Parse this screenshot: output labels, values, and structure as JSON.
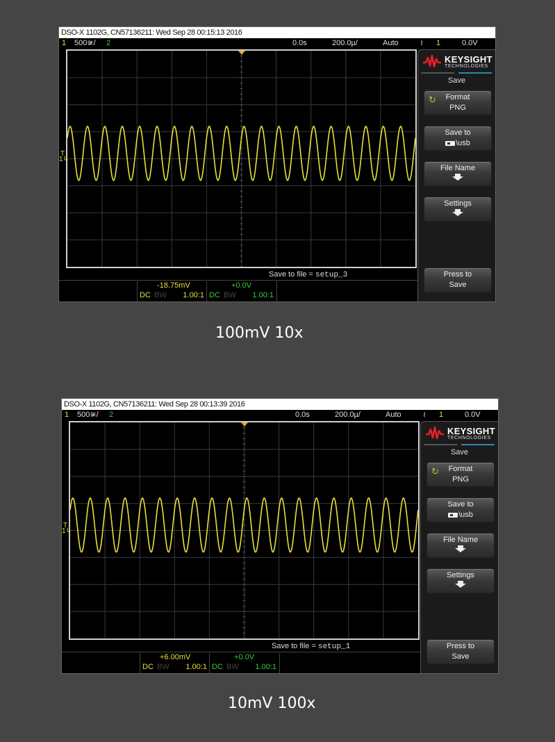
{
  "screens": [
    {
      "titlebar": "DSO-X 1102G, CN57136211: Wed Sep 28 00:15:13 2016",
      "status": {
        "ch1_num": "1",
        "ch1_scale": "500≆/",
        "ch2_num": "2",
        "time_offset": "0.0s",
        "time_scale": "200.0µ/",
        "trigger_mode": "Auto",
        "trigger_slope_icon": "≀",
        "trigger_source": "1",
        "trigger_level": "0.0V"
      },
      "waveform": {
        "channel": "1",
        "cycles_on_screen": 20,
        "amplitude_div": 1.0,
        "offset_div": 0.2,
        "color": "#e8e03a"
      },
      "trigger_label": "T",
      "channel_marker": "1",
      "save_file_label": "Save to file = ",
      "save_file_name": "setup_3",
      "ch1_info": {
        "value": "-18.75mV",
        "coupling": "DC",
        "bw": "BW",
        "probe": "1.00:1"
      },
      "ch2_info": {
        "value": "+0.0V",
        "coupling": "DC",
        "bw": "BW",
        "probe": "1.00:1"
      },
      "softkeys": {
        "brand": "KEYSIGHT",
        "brand_sub": "TECHNOLOGIES",
        "menu_title": "Save",
        "format": {
          "line1": "Format",
          "line2": "PNG"
        },
        "save_to": {
          "line1": "Save to",
          "line2": "\\usb"
        },
        "file_name": {
          "line1": "File Name"
        },
        "settings": {
          "line1": "Settings"
        },
        "press_save": {
          "line1": "Press to",
          "line2": "Save"
        }
      },
      "caption": "100mV 10x"
    },
    {
      "titlebar": "DSO-X 1102G, CN57136211: Wed Sep 28 00:13:39 2016",
      "status": {
        "ch1_num": "1",
        "ch1_scale": "500≆/",
        "ch2_num": "2",
        "time_offset": "0.0s",
        "time_scale": "200.0µ/",
        "trigger_mode": "Auto",
        "trigger_slope_icon": "≀",
        "trigger_source": "1",
        "trigger_level": "0.0V"
      },
      "waveform": {
        "channel": "1",
        "cycles_on_screen": 20,
        "amplitude_div": 1.0,
        "offset_div": 0.2,
        "color": "#e8e03a"
      },
      "trigger_label": "T",
      "channel_marker": "1",
      "save_file_label": "Save to file = ",
      "save_file_name": "setup_1",
      "ch1_info": {
        "value": "+6.00mV",
        "coupling": "DC",
        "bw": "BW",
        "probe": "1.00:1"
      },
      "ch2_info": {
        "value": "+0.0V",
        "coupling": "DC",
        "bw": "BW",
        "probe": "1.00:1"
      },
      "softkeys": {
        "brand": "KEYSIGHT",
        "brand_sub": "TECHNOLOGIES",
        "menu_title": "Save",
        "format": {
          "line1": "Format",
          "line2": "PNG"
        },
        "save_to": {
          "line1": "Save to",
          "line2": "\\usb"
        },
        "file_name": {
          "line1": "File Name"
        },
        "settings": {
          "line1": "Settings"
        },
        "press_save": {
          "line1": "Press to",
          "line2": "Save"
        }
      },
      "caption": "10mV 100x"
    }
  ],
  "colors": {
    "ch1": "#e8e03a",
    "ch2": "#3ec93e",
    "trigger_marker": "#f0a030",
    "brand_red": "#e4202a",
    "accent_line": "#2a8ab0"
  }
}
